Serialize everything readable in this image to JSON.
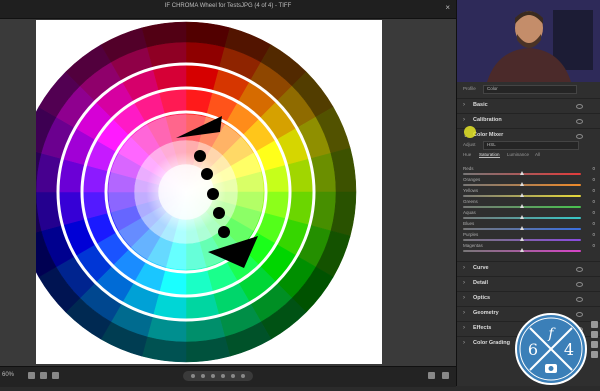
{
  "window": {
    "title": "IF CHROMA Wheel for TestsJPG (4 of 4) - TIFF",
    "close_label": "×"
  },
  "statusbar": {
    "zoom": "60%"
  },
  "panel": {
    "profile_label": "Profile",
    "profile_value": "Color",
    "sections_top": [
      {
        "name": "Basic"
      },
      {
        "name": "Calibration"
      },
      {
        "name": "Color Mixer"
      }
    ],
    "color_mixer": {
      "adjust_label": "Adjust",
      "adjust_value": "HSL",
      "tabs": [
        "Hue",
        "Saturation",
        "Luminance",
        "All"
      ],
      "active_tab": "Saturation",
      "sliders": [
        {
          "label": "Reds",
          "value": "0",
          "color": "#e23b3b"
        },
        {
          "label": "Oranges",
          "value": "0",
          "color": "#ef8a2a"
        },
        {
          "label": "Yellows",
          "value": "0",
          "color": "#e6d83a"
        },
        {
          "label": "Greens",
          "value": "0",
          "color": "#48c14e"
        },
        {
          "label": "Aquas",
          "value": "0",
          "color": "#37c7c7"
        },
        {
          "label": "Blues",
          "value": "0",
          "color": "#3a6fe0"
        },
        {
          "label": "Purples",
          "value": "0",
          "color": "#8a4be0"
        },
        {
          "label": "Magentas",
          "value": "0",
          "color": "#d744c8"
        }
      ]
    },
    "sections_bottom": [
      {
        "name": "Curve"
      },
      {
        "name": "Detail"
      },
      {
        "name": "Optics"
      },
      {
        "name": "Geometry"
      },
      {
        "name": "Effects"
      },
      {
        "name": "Color Grading"
      }
    ]
  },
  "logo": {
    "top_letter": "f",
    "left_digit": "6",
    "right_digit": "4"
  }
}
